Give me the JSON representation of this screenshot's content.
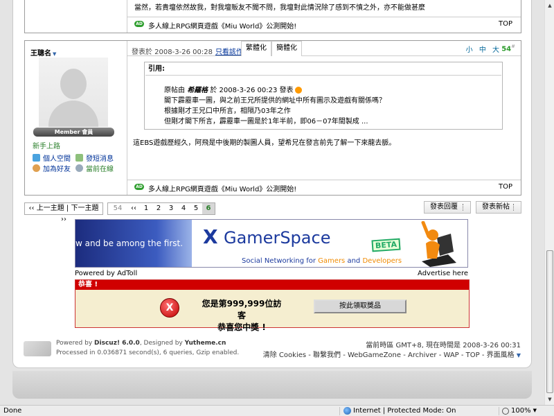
{
  "post1": {
    "text": "當然，若貴壇依然故我，對我壇販友不聞不問，我壇對此情況除了感到不憤之外，亦不能做甚麼",
    "sig": "多人線上RPG網頁遊戲《Miu World》公測開始!",
    "top": "TOP"
  },
  "post2": {
    "author": "王聰名",
    "badge": "Member 會員",
    "rank": "新手上路",
    "actions": {
      "space": "個人空間",
      "pm": "發短消息",
      "friend": "加為好友",
      "online": "當前在線"
    },
    "time": "發表於 2008-3-26 00:28",
    "only_author": "只看該作者",
    "tab_trad": "繁體化",
    "tab_simp": "簡體化",
    "font_sizes": "小 中 大",
    "floor": "54",
    "floor_sup": "#",
    "quote_label": "引用:",
    "quote_lines": {
      "l1_prefix": "原帖由",
      "l1_author": "希羅格",
      "l1_suffix": "於 2008-3-26 00:23 發表",
      "l2": "閣下霹靂車一圖，與之前王兄所提供的網址中所有圖示及遊戲有關係嗎？",
      "l3": "根據剛才王兄口中所言，相隔乃03年之作",
      "l4": "但剛才閣下所言，霹靂車一圖是於1年半前，即06－07年間製成 ..."
    },
    "reply": "這EBS遊戲歷經久，阿飛是中後期的製圖人員，望希兄在發言前先了解一下來龍去脈。",
    "sig": "多人線上RPG網頁遊戲《Miu World》公測開始!",
    "top": "TOP"
  },
  "pager": {
    "prev": "‹‹ 上一主題",
    "next": "下一主題 ››",
    "total": "54",
    "first": "‹‹",
    "pages": [
      "1",
      "2",
      "3",
      "4",
      "5"
    ],
    "current": "6",
    "reply_btn": "發表回覆",
    "new_btn": "發表新帖"
  },
  "ad": {
    "left_text": "w and be among the first.",
    "logo_x": "X",
    "logo": "GamerSpace",
    "beta": "BETA",
    "tag_a": "Social Networking for",
    "tag_b": "Gamers",
    "tag_c": "and",
    "tag_d": "Developers",
    "powered": "Powered by AdToll",
    "advertise": "Advertise here"
  },
  "prize": {
    "title": "恭喜 !",
    "x": "X",
    "line1": "您是第999,999位訪客",
    "line2": "恭喜您中獎 !",
    "button": "按此領取獎品"
  },
  "footer": {
    "powered_prefix": "Powered by",
    "powered_name": "Discuz! 6.0.0",
    "designed_prefix": ", Designed by",
    "designed_name": "Yutheme.cn",
    "processed": "Processed in 0.036871 second(s), 6 queries, Gzip enabled.",
    "timezone": "當前時區 GMT+8, 現在時間是 2008-3-26 00:31",
    "links": "清除 Cookies - 聯繫我們 - WebGameZone - Archiver - WAP - TOP - 界面風格"
  },
  "status": {
    "done": "Done",
    "zone": "Internet | Protected Mode: On",
    "zoom": "100%"
  },
  "colors": {
    "accent": "#003399",
    "green": "#2a7f2a",
    "red": "#d00000"
  }
}
